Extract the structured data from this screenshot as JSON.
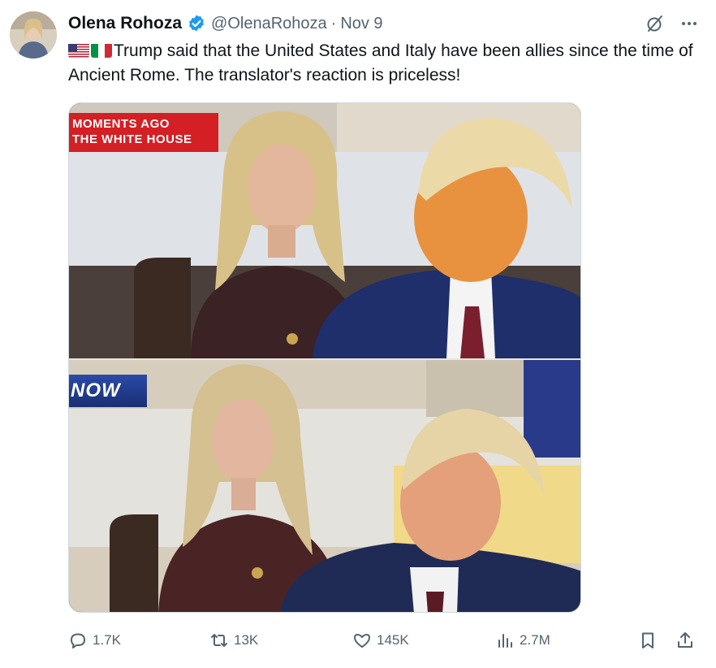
{
  "tweet": {
    "author": {
      "name": "Olena Rohoza",
      "handle": "@OlenaRohoza",
      "verified": true,
      "verified_color": "#1d9bf0"
    },
    "separator": "·",
    "date": "Nov 9",
    "text": "Trump said that the United States and Italy have been allies since the time of Ancient Rome. The translator's reaction is priceless!",
    "flags": [
      "us-flag-icon",
      "italy-flag-icon"
    ],
    "media": {
      "top_panel": {
        "chyron_line1": "MOMENTS AGO",
        "chyron_line2": "THE WHITE HOUSE"
      },
      "bottom_panel": {
        "logo_text": "NOW"
      }
    },
    "actions": {
      "replies": "1.7K",
      "retweets": "13K",
      "likes": "145K",
      "views": "2.7M"
    }
  },
  "colors": {
    "text_primary": "#0f1419",
    "text_secondary": "#536471",
    "chyron_red": "#d41f24"
  }
}
